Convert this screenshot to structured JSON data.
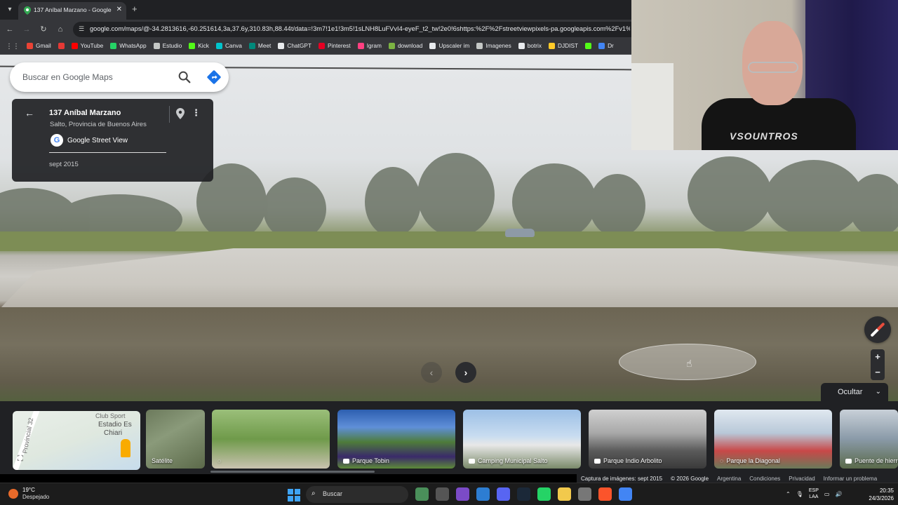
{
  "browser": {
    "tab_title": "137 Aníbal Marzano - Google M",
    "url": "google.com/maps/@-34.2813616,-60.251614,3a,37.6y,310.83h,88.44t/data=!3m7!1e1!3m5!1sLNH8LuFVvI4-eyeF_t2_tw!2e0!6shttps:%2F%2Fstreetviewpixels-pa.googleapis.com%2Fv1%2Fth",
    "bookmarks": [
      {
        "label": "Gmail",
        "color": "#ea4335"
      },
      {
        "label": "",
        "color": "#e53935"
      },
      {
        "label": "YouTube",
        "color": "#ff0000"
      },
      {
        "label": "WhatsApp",
        "color": "#25d366"
      },
      {
        "label": "Estudio",
        "color": "#c4c7c5"
      },
      {
        "label": "Kick",
        "color": "#53fc18"
      },
      {
        "label": "Canva",
        "color": "#00c4cc"
      },
      {
        "label": "Meet",
        "color": "#00897b"
      },
      {
        "label": "ChatGPT",
        "color": "#e8eaed"
      },
      {
        "label": "Pinterest",
        "color": "#e60023"
      },
      {
        "label": "Igram",
        "color": "#ff4081"
      },
      {
        "label": "download",
        "color": "#7cb342"
      },
      {
        "label": "Upscaler im",
        "color": "#e8eaed"
      },
      {
        "label": "Imagenes",
        "color": "#c4c7c5"
      },
      {
        "label": "botrix",
        "color": "#e8eaed"
      },
      {
        "label": "DJDIST",
        "color": "#ffca28"
      },
      {
        "label": "",
        "color": "#53fc18"
      },
      {
        "label": "Dr",
        "color": "#4285f4"
      }
    ]
  },
  "search": {
    "placeholder": "Buscar en Google Maps"
  },
  "card": {
    "title": "137 Aníbal Marzano",
    "subtitle": "Salto, Provincia de Buenos Aires",
    "source": "Google Street View",
    "date": "sept 2015"
  },
  "webcam": {
    "shirt_text": "VSOUNTROS"
  },
  "controls": {
    "hide_label": "Ocultar"
  },
  "minimap": {
    "label1": "Club Sport",
    "label2": "Estadio Es",
    "label3": "Chiari",
    "road_label": "Provincial 32",
    "layer_label": "Satélite"
  },
  "photos": [
    {
      "label": "",
      "type": "360",
      "bg": "linear-gradient(180deg,#9bbf7a 0%,#6f9a4a 50%,#c9c2b0 100%)"
    },
    {
      "label": "Parque Tobin",
      "type": "photo",
      "bg": "linear-gradient(180deg,#2d5fb0 0%,#5f8fd8 30%,#4e7c3a 55%,#3a2a6a 80%,#5d8a38 100%)"
    },
    {
      "label": "Camping Municipal Salto",
      "type": "photo",
      "bg": "linear-gradient(180deg,#9dc0e6 0%,#c8dcf0 45%,#e8e8e8 60%,#7a8a6a 100%)"
    },
    {
      "label": "Parque Indio Arbolito",
      "type": "photo",
      "bg": "linear-gradient(180deg,#d0d0d0 0%,#a8a8a8 40%,#5a5a5a 70%,#3a3a3a 100%)"
    },
    {
      "label": "Parque la Diagonal",
      "type": "360",
      "bg": "linear-gradient(180deg,#e0e8f0 0%,#b8c8d8 40%,#c84848 70%,#6a7a5a 100%)"
    },
    {
      "label": "Puente de hierro",
      "type": "photo",
      "bg": "linear-gradient(180deg,#c8d0d8 0%,#8a9aa8 50%,#5a6a4a 100%)"
    }
  ],
  "footer": {
    "capture": "Captura de imágenes: sept 2015",
    "copyright": "© 2026 Google",
    "country": "Argentina",
    "terms": "Condiciones",
    "privacy": "Privacidad",
    "report": "Informar un problema"
  },
  "taskbar": {
    "temp": "19°C",
    "condition": "Despejado",
    "search_label": "Buscar",
    "lang_top": "ESP",
    "lang_bottom": "LAA",
    "time": "20:35",
    "date": "24/3/2026",
    "apps": [
      {
        "name": "widgets",
        "color": "#4a8f5a"
      },
      {
        "name": "file-app",
        "color": "#555"
      },
      {
        "name": "podcast-app",
        "color": "#7b4bc7"
      },
      {
        "name": "notes-app",
        "color": "#2d7dd2"
      },
      {
        "name": "discord-app",
        "color": "#5865f2"
      },
      {
        "name": "steam-app",
        "color": "#1b2838"
      },
      {
        "name": "whatsapp-app",
        "color": "#25d366"
      },
      {
        "name": "explorer-app",
        "color": "#f2c94c"
      },
      {
        "name": "settings-app",
        "color": "#777"
      },
      {
        "name": "brave-app",
        "color": "#fb542b"
      },
      {
        "name": "chrome-app",
        "color": "#4285f4"
      }
    ]
  }
}
